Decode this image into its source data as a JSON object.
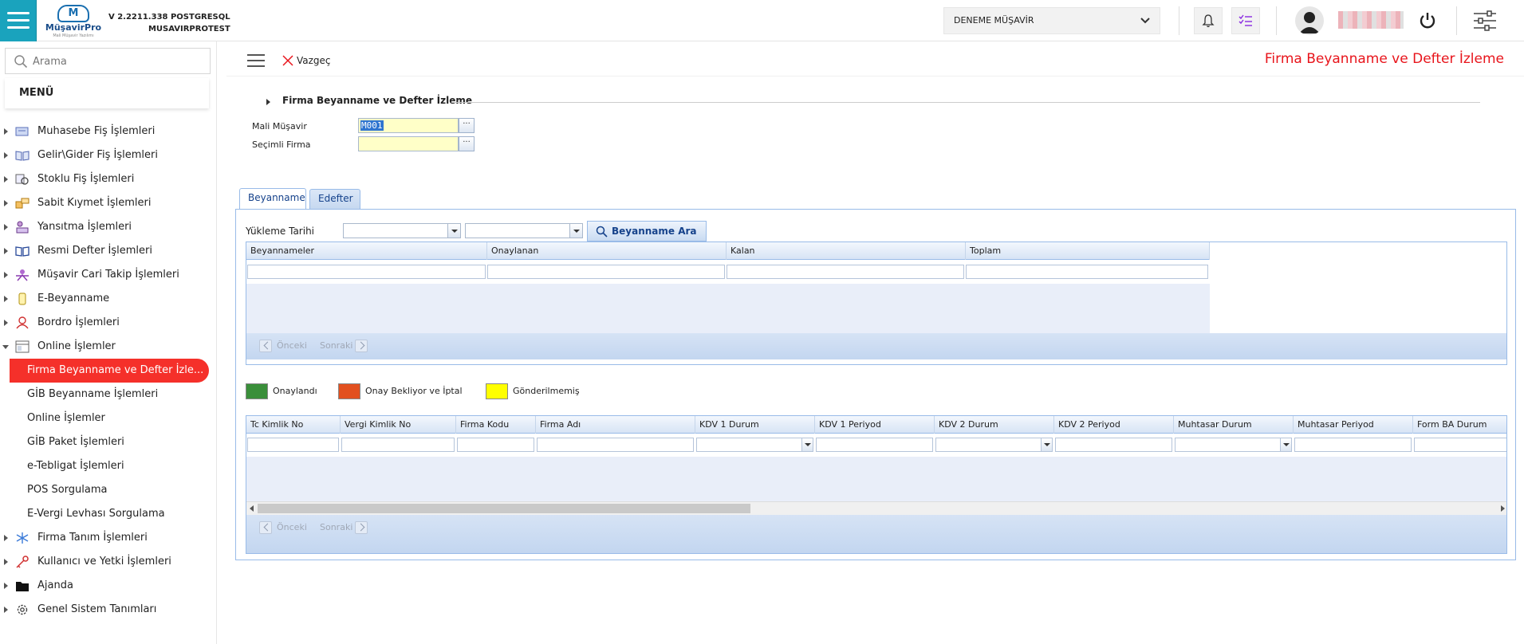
{
  "app": {
    "version_line1": "V 2.2211.338 POSTGRESQL",
    "version_line2": "MUSAVIRPROTEST",
    "logo_brand": "MüşavirPro",
    "logo_tagline": "Mali Müşavir Yazılımı"
  },
  "header": {
    "company_select_value": "DENEME MÜŞAVİR"
  },
  "sidebar": {
    "search_placeholder": "Arama",
    "menu_title": "MENÜ",
    "items": [
      {
        "label": "Muhasebe Fiş İşlemleri",
        "icon": "ledger-icon"
      },
      {
        "label": "Gelir\\Gider Fiş İşlemleri",
        "icon": "book-icon"
      },
      {
        "label": "Stoklu Fiş İşlemleri",
        "icon": "stock-icon"
      },
      {
        "label": "Sabit Kıymet İşlemleri",
        "icon": "assets-icon"
      },
      {
        "label": "Yansıtma İşlemleri",
        "icon": "reflection-icon"
      },
      {
        "label": "Resmi Defter İşlemleri",
        "icon": "open-book-icon"
      },
      {
        "label": "Müşavir Cari Takip İşlemleri",
        "icon": "tracking-icon"
      },
      {
        "label": "E-Beyanname",
        "icon": "phone-icon"
      },
      {
        "label": "Bordro İşlemleri",
        "icon": "payroll-icon"
      },
      {
        "label": "Online İşlemler",
        "icon": "browser-icon"
      }
    ],
    "online_sub": [
      {
        "label": "Firma Beyanname ve Defter İzle..."
      },
      {
        "label": "GİB Beyanname İşlemleri"
      },
      {
        "label": "Online İşlemler"
      },
      {
        "label": "GİB Paket İşlemleri"
      },
      {
        "label": "e-Tebligat İşlemleri"
      },
      {
        "label": "POS Sorgulama"
      },
      {
        "label": "E-Vergi Levhası Sorgulama"
      }
    ],
    "items_after": [
      {
        "label": "Firma Tanım İşlemleri",
        "icon": "snowflake-icon"
      },
      {
        "label": "Kullanıcı ve Yetki İşlemleri",
        "icon": "key-icon"
      },
      {
        "label": "Ajanda",
        "icon": "folder-icon"
      },
      {
        "label": "Genel Sistem Tanımları",
        "icon": "gear-icon"
      }
    ]
  },
  "toolbar": {
    "cancel_label": "Vazgeç",
    "page_title": "Firma Beyanname ve Defter İzleme"
  },
  "form": {
    "fieldset_title": "Firma Beyanname ve Defter İzleme",
    "mali_musavir_label": "Mali Müşavir",
    "mali_musavir_value": "M001",
    "secimli_firma_label": "Seçimli Firma",
    "secimli_firma_value": "",
    "dots": "···"
  },
  "tabs": [
    {
      "label": "Beyanname",
      "active": true
    },
    {
      "label": "Edefter",
      "active": false
    }
  ],
  "beyanname": {
    "yukleme_tarihi_label": "Yükleme Tarihi",
    "search_button": "Beyanname Ara",
    "summary_columns": [
      "Beyannameler",
      "Onaylanan",
      "Kalan",
      "Toplam"
    ],
    "pager_prev": "Önceki",
    "pager_next": "Sonraki",
    "legend": [
      {
        "label": "Onaylandı",
        "color": "#3a8f3a"
      },
      {
        "label": "Onay Bekliyor ve İptal",
        "color": "#e2501f"
      },
      {
        "label": "Gönderilmemiş",
        "color": "#ffff00"
      }
    ],
    "detail_columns": [
      "Tc Kimlik No",
      "Vergi Kimlik No",
      "Firma Kodu",
      "Firma Adı",
      "KDV 1 Durum",
      "KDV 1 Periyod",
      "KDV 2 Durum",
      "KDV 2 Periyod",
      "Muhtasar Durum",
      "Muhtasar Periyod",
      "Form BA Durum"
    ]
  },
  "colors": {
    "accent": "#1aa3bd",
    "active_menu": "#f5302a",
    "title_red": "#e8141b"
  }
}
